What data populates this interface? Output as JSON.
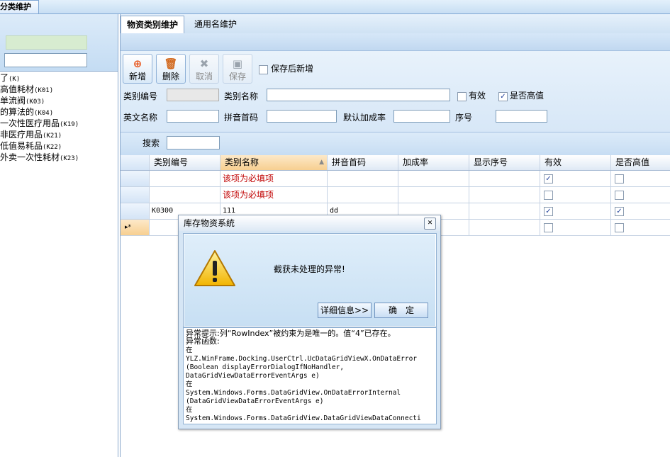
{
  "app": {
    "doc_tab": "分类维护"
  },
  "left": {
    "tree": [
      {
        "name": "",
        "code": "(K)",
        "prefix": "了"
      },
      {
        "name": "高值耗材",
        "code": "(K01)"
      },
      {
        "name": "单流阀",
        "code": "(K03)"
      },
      {
        "name": "的算法的",
        "code": "(K04)"
      },
      {
        "name": "一次性医疗用品",
        "code": "(K19)"
      },
      {
        "name": "非医疗用品",
        "code": "(K21)"
      },
      {
        "name": "低值易耗品",
        "code": "(K22)"
      },
      {
        "name": "外卖一次性耗材",
        "code": "(K23)"
      }
    ]
  },
  "tabs": {
    "active": "物资类别维护",
    "inactive": "通用名维护"
  },
  "toolbar": {
    "add": "新增",
    "delete": "删除",
    "cancel": "取消",
    "save": "保存",
    "save_then_add": "保存后新增",
    "add_icon": "add-circle-icon",
    "delete_icon": "trash-icon",
    "cancel_icon": "x-icon",
    "save_icon": "floppy-icon"
  },
  "form": {
    "category_code_label": "类别编号",
    "category_name_label": "类别名称",
    "valid_label": "有效",
    "valid_checked": false,
    "high_value_label": "是否高值",
    "high_value_checked": true,
    "english_name_label": "英文名称",
    "pinyin_label": "拼音首码",
    "markup_label": "默认加成率",
    "seq_label": "序号"
  },
  "search": {
    "label": "搜索",
    "value": ""
  },
  "grid": {
    "columns": [
      "类别编号",
      "类别名称",
      "拼音首码",
      "加成率",
      "显示序号",
      "有效",
      "是否高值"
    ],
    "sorted_column": 1,
    "rows": [
      {
        "header": "",
        "code": "",
        "name": "该项为必填项",
        "name_error": true,
        "pinyin": "",
        "rate": "",
        "seq": "",
        "valid": true,
        "high": false
      },
      {
        "header": "",
        "code": "",
        "name": "该项为必填项",
        "name_error": true,
        "pinyin": "",
        "rate": "",
        "seq": "",
        "valid": false,
        "high": false
      },
      {
        "header": "",
        "code": "K0300",
        "name": "111",
        "name_error": false,
        "pinyin": "dd",
        "rate": "",
        "seq": "",
        "valid": true,
        "high": true
      },
      {
        "header": "▸*",
        "code": "",
        "name": "",
        "name_error": false,
        "pinyin": "",
        "rate": "",
        "seq": "",
        "valid": false,
        "high": false
      }
    ]
  },
  "dialog": {
    "title": "库存物资系统",
    "message": "截获未处理的异常!",
    "details_button": "详细信息>>",
    "ok_button": "确　定",
    "warning_icon": "warning-icon",
    "detail_lines": [
      "异常提示:列“RowIndex”被约束为是唯一的。值“4”已存在。",
      "异常函数:",
      "    在",
      "YLZ.WinFrame.Docking.UserCtrl.UcDataGridViewX.OnDataError",
      "(Boolean displayErrorDialogIfNoHandler,",
      "DataGridViewDataErrorEventArgs e)",
      "    在",
      "System.Windows.Forms.DataGridView.OnDataErrorInternal",
      "(DataGridViewDataErrorEventArgs e)",
      "    在",
      "System.Windows.Forms.DataGridView.DataGridViewDataConnecti"
    ]
  }
}
